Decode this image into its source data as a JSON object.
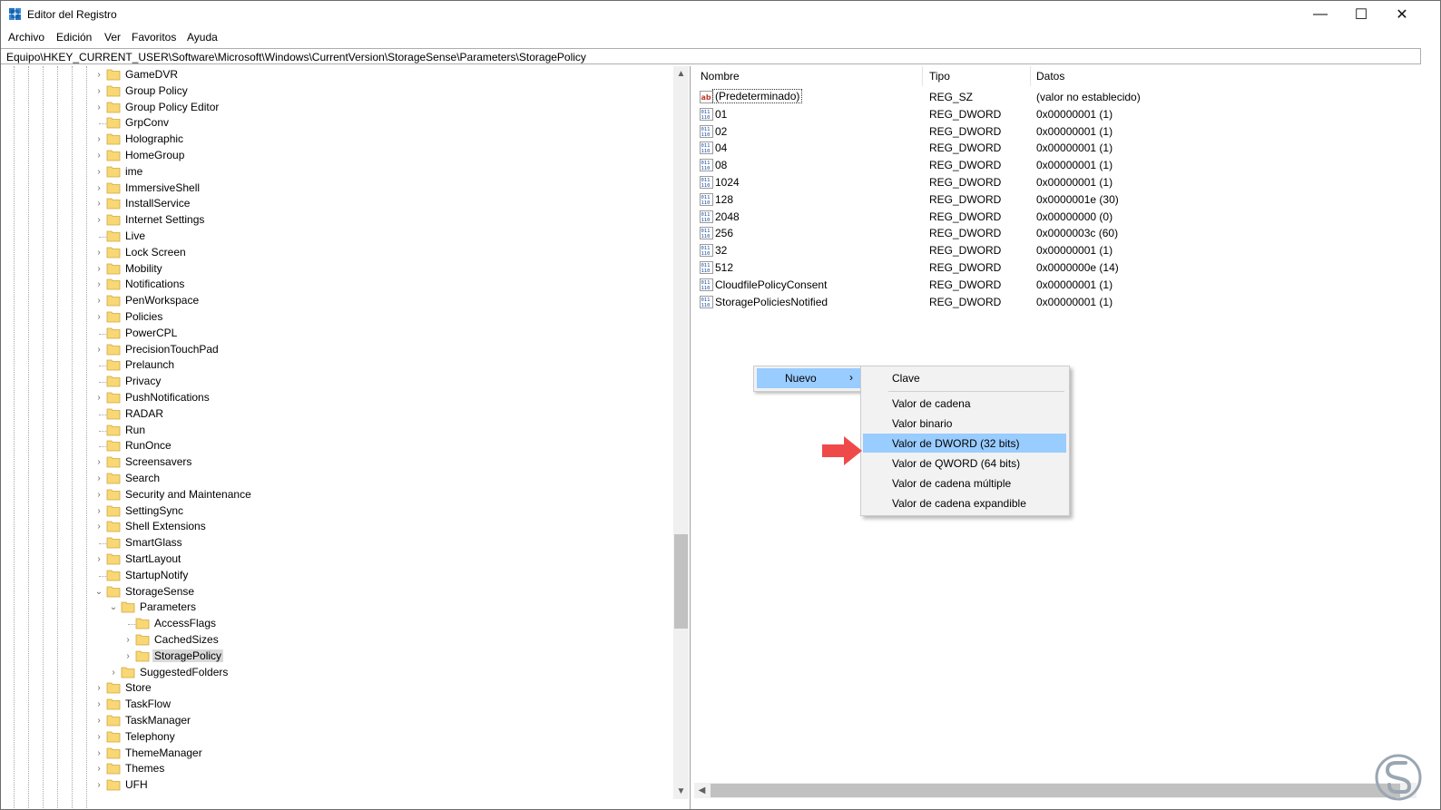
{
  "window": {
    "title": "Editor del Registro",
    "controls": {
      "minimize": "—",
      "maximize": "☐",
      "close": "✕"
    }
  },
  "menubar": [
    "Archivo",
    "Edición",
    "Ver",
    "Favoritos",
    "Ayuda"
  ],
  "address": "Equipo\\HKEY_CURRENT_USER\\Software\\Microsoft\\Windows\\CurrentVersion\\StorageSense\\Parameters\\StoragePolicy",
  "tree": {
    "items": [
      {
        "label": "GameDVR",
        "expander": "›"
      },
      {
        "label": "Group Policy",
        "expander": "›"
      },
      {
        "label": "Group Policy Editor",
        "expander": "›"
      },
      {
        "label": "GrpConv",
        "expander": ""
      },
      {
        "label": "Holographic",
        "expander": "›"
      },
      {
        "label": "HomeGroup",
        "expander": "›"
      },
      {
        "label": "ime",
        "expander": "›"
      },
      {
        "label": "ImmersiveShell",
        "expander": "›"
      },
      {
        "label": "InstallService",
        "expander": "›"
      },
      {
        "label": "Internet Settings",
        "expander": "›"
      },
      {
        "label": "Live",
        "expander": ""
      },
      {
        "label": "Lock Screen",
        "expander": "›"
      },
      {
        "label": "Mobility",
        "expander": "›"
      },
      {
        "label": "Notifications",
        "expander": "›"
      },
      {
        "label": "PenWorkspace",
        "expander": "›"
      },
      {
        "label": "Policies",
        "expander": "›"
      },
      {
        "label": "PowerCPL",
        "expander": ""
      },
      {
        "label": "PrecisionTouchPad",
        "expander": "›"
      },
      {
        "label": "Prelaunch",
        "expander": ""
      },
      {
        "label": "Privacy",
        "expander": ""
      },
      {
        "label": "PushNotifications",
        "expander": "›"
      },
      {
        "label": "RADAR",
        "expander": ""
      },
      {
        "label": "Run",
        "expander": ""
      },
      {
        "label": "RunOnce",
        "expander": ""
      },
      {
        "label": "Screensavers",
        "expander": "›"
      },
      {
        "label": "Search",
        "expander": "›"
      },
      {
        "label": "Security and Maintenance",
        "expander": "›"
      },
      {
        "label": "SettingSync",
        "expander": "›"
      },
      {
        "label": "Shell Extensions",
        "expander": "›"
      },
      {
        "label": "SmartGlass",
        "expander": ""
      },
      {
        "label": "StartLayout",
        "expander": "›"
      },
      {
        "label": "StartupNotify",
        "expander": ""
      },
      {
        "label": "StorageSense",
        "expander": "⌄"
      },
      {
        "label": "Parameters",
        "expander": "⌄"
      },
      {
        "label": "AccessFlags",
        "expander": ""
      },
      {
        "label": "CachedSizes",
        "expander": "›"
      },
      {
        "label": "StoragePolicy",
        "expander": "›"
      },
      {
        "label": "SuggestedFolders",
        "expander": "›"
      },
      {
        "label": "Store",
        "expander": "›"
      },
      {
        "label": "TaskFlow",
        "expander": "›"
      },
      {
        "label": "TaskManager",
        "expander": "›"
      },
      {
        "label": "Telephony",
        "expander": "›"
      },
      {
        "label": "ThemeManager",
        "expander": "›"
      },
      {
        "label": "Themes",
        "expander": "›"
      },
      {
        "label": "UFH",
        "expander": "›"
      }
    ]
  },
  "list": {
    "columns": [
      "Nombre",
      "Tipo",
      "Datos"
    ],
    "rows": [
      {
        "name": "(Predeterminado)",
        "type": "REG_SZ",
        "data": "(valor no establecido)",
        "icon": "string-value-icon"
      },
      {
        "name": "01",
        "type": "REG_DWORD",
        "data": "0x00000001 (1)",
        "icon": "binary-value-icon"
      },
      {
        "name": "02",
        "type": "REG_DWORD",
        "data": "0x00000001 (1)",
        "icon": "binary-value-icon"
      },
      {
        "name": "04",
        "type": "REG_DWORD",
        "data": "0x00000001 (1)",
        "icon": "binary-value-icon"
      },
      {
        "name": "08",
        "type": "REG_DWORD",
        "data": "0x00000001 (1)",
        "icon": "binary-value-icon"
      },
      {
        "name": "1024",
        "type": "REG_DWORD",
        "data": "0x00000001 (1)",
        "icon": "binary-value-icon"
      },
      {
        "name": "128",
        "type": "REG_DWORD",
        "data": "0x0000001e (30)",
        "icon": "binary-value-icon"
      },
      {
        "name": "2048",
        "type": "REG_DWORD",
        "data": "0x00000000 (0)",
        "icon": "binary-value-icon"
      },
      {
        "name": "256",
        "type": "REG_DWORD",
        "data": "0x0000003c (60)",
        "icon": "binary-value-icon"
      },
      {
        "name": "32",
        "type": "REG_DWORD",
        "data": "0x00000001 (1)",
        "icon": "binary-value-icon"
      },
      {
        "name": "512",
        "type": "REG_DWORD",
        "data": "0x0000000e (14)",
        "icon": "binary-value-icon"
      },
      {
        "name": "CloudfilePolicyConsent",
        "type": "REG_DWORD",
        "data": "0x00000001 (1)",
        "icon": "binary-value-icon"
      },
      {
        "name": "StoragePoliciesNotified",
        "type": "REG_DWORD",
        "data": "0x00000001 (1)",
        "icon": "binary-value-icon"
      }
    ]
  },
  "context_menu": {
    "nuevo": "Nuevo",
    "submenu": [
      "Clave",
      "Valor de cadena",
      "Valor binario",
      "Valor de DWORD (32 bits)",
      "Valor de QWORD (64 bits)",
      "Valor de cadena múltiple",
      "Valor de cadena expandible"
    ],
    "highlighted": "Valor de DWORD (32 bits)"
  },
  "colors": {
    "highlight": "#99ccff",
    "folder": "#f8d775",
    "arrow": "#ef4a4a",
    "watermark": "#9aa6b2"
  }
}
